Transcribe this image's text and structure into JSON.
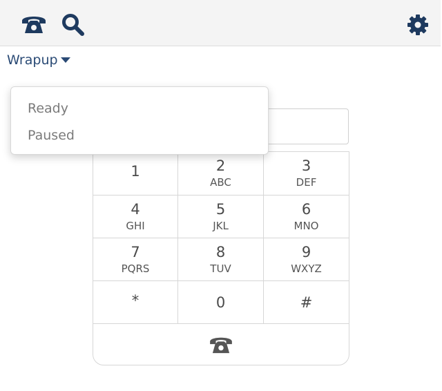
{
  "topbar": {
    "left_icons": [
      "phone-icon",
      "search-icon"
    ],
    "right_icon": "gear-icon"
  },
  "status": {
    "label": "Wrapup"
  },
  "dropdown": {
    "items": [
      "Ready",
      "Paused"
    ]
  },
  "dialpad": {
    "keys": [
      {
        "digit": "1",
        "letters": ""
      },
      {
        "digit": "2",
        "letters": "ABC"
      },
      {
        "digit": "3",
        "letters": "DEF"
      },
      {
        "digit": "4",
        "letters": "GHI"
      },
      {
        "digit": "5",
        "letters": "JKL"
      },
      {
        "digit": "6",
        "letters": "MNO"
      },
      {
        "digit": "7",
        "letters": "PQRS"
      },
      {
        "digit": "8",
        "letters": "TUV"
      },
      {
        "digit": "9",
        "letters": "WXYZ"
      },
      {
        "digit": "*",
        "letters": ""
      },
      {
        "digit": "0",
        "letters": ""
      },
      {
        "digit": "#",
        "letters": ""
      }
    ],
    "call_icon": "phone-icon"
  },
  "colors": {
    "icon_dark": "#1e3a5f",
    "status_text": "#2a4a75",
    "topbar_bg": "#f4f4f4",
    "keypad_text": "#4a4a4a"
  }
}
